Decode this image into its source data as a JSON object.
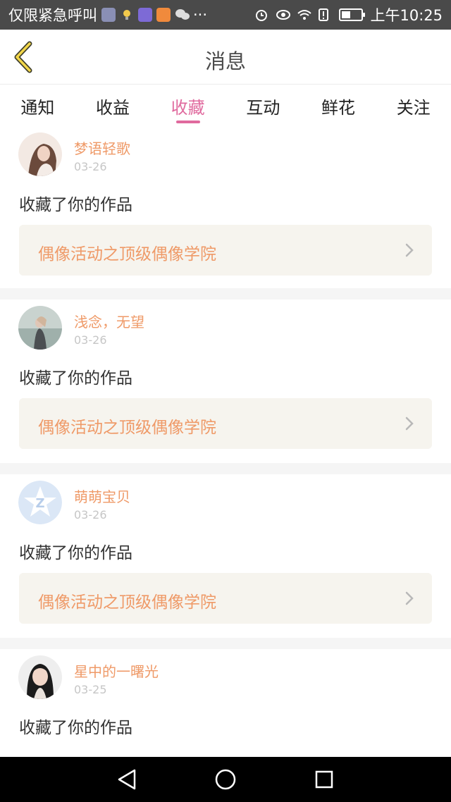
{
  "status_bar": {
    "carrier": "仅限紧急呼叫",
    "more": "···",
    "time": "上午10:25",
    "battery_level": 0.45
  },
  "header": {
    "title": "消息"
  },
  "tabs": [
    {
      "label": "通知",
      "active": false
    },
    {
      "label": "收益",
      "active": false
    },
    {
      "label": "收藏",
      "active": true
    },
    {
      "label": "互动",
      "active": false
    },
    {
      "label": "鲜花",
      "active": false
    },
    {
      "label": "关注",
      "active": false
    }
  ],
  "colors": {
    "accent": "#e06a9e",
    "name": "#ef9a68",
    "card_link_bg": "#f6f4ee"
  },
  "messages": [
    {
      "user": "梦语轻歌",
      "date": "03-26",
      "action": "收藏了你的作品",
      "work": "偶像活动之顶级偶像学院",
      "avatar": "photo-girl-avatar"
    },
    {
      "user": "浅念，无望",
      "date": "03-26",
      "action": "收藏了你的作品",
      "work": "偶像活动之顶级偶像学院",
      "avatar": "photo-sea-avatar"
    },
    {
      "user": "萌萌宝贝",
      "date": "03-26",
      "action": "收藏了你的作品",
      "work": "偶像活动之顶级偶像学院",
      "avatar": "default-star-avatar"
    },
    {
      "user": "星中的一曙光",
      "date": "03-25",
      "action": "收藏了你的作品",
      "work": "",
      "avatar": "photo-girl2-avatar"
    }
  ]
}
